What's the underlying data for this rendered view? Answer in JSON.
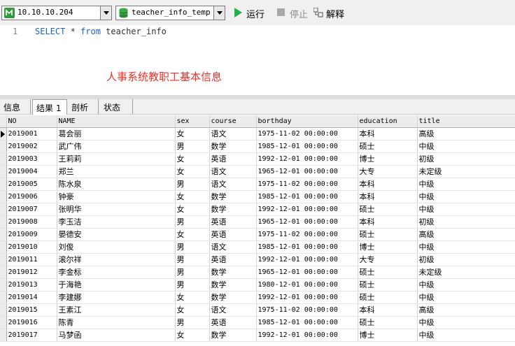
{
  "toolbar": {
    "connection": "10.10.10.204",
    "database": "teacher_info_temp",
    "run_label": "运行",
    "stop_label": "停止",
    "explain_label": "解释"
  },
  "editor": {
    "line_number": "1",
    "sql_keyword_select": "SELECT",
    "sql_star": " * ",
    "sql_keyword_from": "from",
    "sql_table": " teacher_info",
    "caption": "人事系统教职工基本信息"
  },
  "result_tabs": [
    {
      "label": "信息"
    },
    {
      "label": "结果 1"
    },
    {
      "label": "剖析"
    },
    {
      "label": "状态"
    }
  ],
  "grid": {
    "columns": [
      "NO",
      "NAME",
      "sex",
      "course",
      "borthday",
      "education",
      "title"
    ],
    "rows": [
      [
        "2019001",
        "葛会丽",
        "女",
        "语文",
        "1975-11-02 00:00:00",
        "本科",
        "高级"
      ],
      [
        "2019002",
        "武广伟",
        "男",
        "数学",
        "1985-12-01 00:00:00",
        "硕士",
        "中级"
      ],
      [
        "2019003",
        "王莉莉",
        "女",
        "英语",
        "1992-12-01 00:00:00",
        "博士",
        "初级"
      ],
      [
        "2019004",
        "郑兰",
        "女",
        "语文",
        "1965-12-01 00:00:00",
        "大专",
        "未定级"
      ],
      [
        "2019005",
        "陈水泉",
        "男",
        "语文",
        "1975-11-02 00:00:00",
        "本科",
        "中级"
      ],
      [
        "2019006",
        "钟豪",
        "女",
        "数学",
        "1985-12-01 00:00:00",
        "本科",
        "中级"
      ],
      [
        "2019007",
        "张明华",
        "女",
        "数学",
        "1992-12-01 00:00:00",
        "硕士",
        "中级"
      ],
      [
        "2019008",
        "李玉洁",
        "男",
        "英语",
        "1965-12-01 00:00:00",
        "本科",
        "初级"
      ],
      [
        "2019009",
        "晏德安",
        "女",
        "英语",
        "1975-11-02 00:00:00",
        "硕士",
        "高级"
      ],
      [
        "2019010",
        "刘俊",
        "男",
        "语文",
        "1985-12-01 00:00:00",
        "博士",
        "中级"
      ],
      [
        "2019011",
        "滚尔祥",
        "男",
        "英语",
        "1992-12-01 00:00:00",
        "大专",
        "初级"
      ],
      [
        "2019012",
        "李金标",
        "男",
        "数学",
        "1965-12-01 00:00:00",
        "硕士",
        "未定级"
      ],
      [
        "2019013",
        "于海艳",
        "男",
        "数学",
        "1980-12-01 00:00:00",
        "硕士",
        "中级"
      ],
      [
        "2019014",
        "李建娜",
        "女",
        "数学",
        "1992-12-01 00:00:00",
        "硕士",
        "中级"
      ],
      [
        "2019015",
        "王素江",
        "女",
        "语文",
        "1975-11-02 00:00:00",
        "本科",
        "高级"
      ],
      [
        "2019016",
        "陈青",
        "男",
        "英语",
        "1985-12-01 00:00:00",
        "硕士",
        "中级"
      ],
      [
        "2019017",
        "马梦函",
        "女",
        "数学",
        "1992-12-01 00:00:00",
        "博士",
        "中级"
      ]
    ]
  }
}
